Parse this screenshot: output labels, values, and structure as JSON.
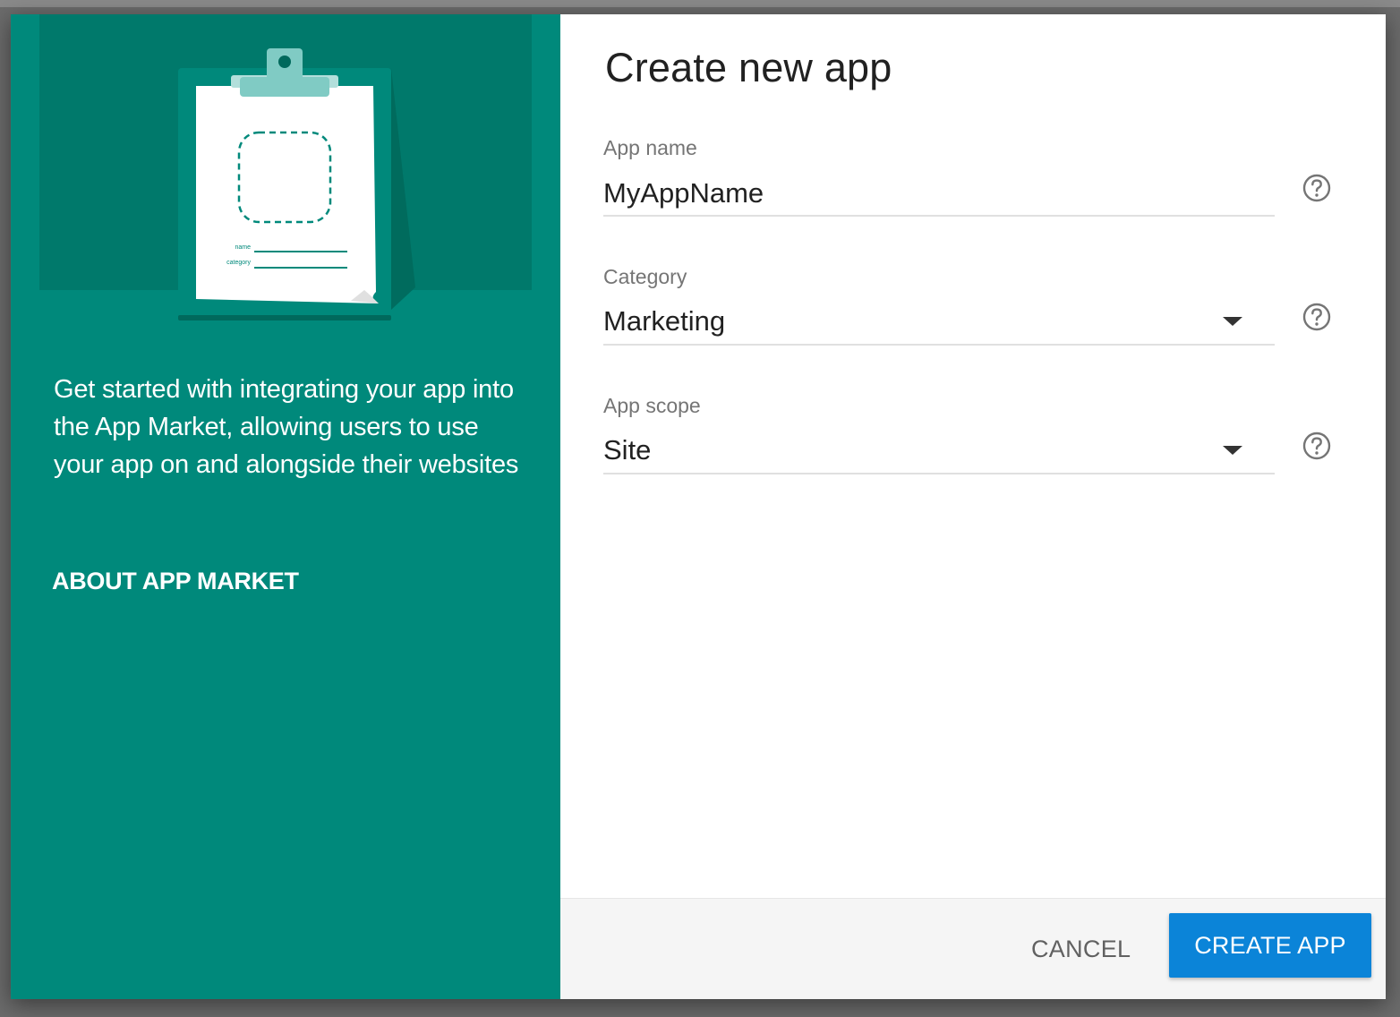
{
  "illustration": {
    "form_labels": [
      "name",
      "category"
    ]
  },
  "left_panel": {
    "intro_text": "Get started with integrating your app into the App Market, allowing users to use your app on and alongside their websites",
    "about_link": "ABOUT APP MARKET"
  },
  "dialog": {
    "title": "Create new app"
  },
  "form": {
    "app_name": {
      "label": "App name",
      "value": "MyAppName"
    },
    "category": {
      "label": "Category",
      "value": "Marketing"
    },
    "app_scope": {
      "label": "App scope",
      "value": "Site"
    }
  },
  "footer": {
    "cancel_label": "CANCEL",
    "create_label": "CREATE APP"
  },
  "colors": {
    "left_panel": "#00897b",
    "illustration_bg": "#00796b",
    "primary_button": "#0b84d8",
    "footer_bg": "#f5f5f5"
  },
  "icons": [
    "clipboard-illustration",
    "help-icon",
    "dropdown-caret-icon"
  ]
}
